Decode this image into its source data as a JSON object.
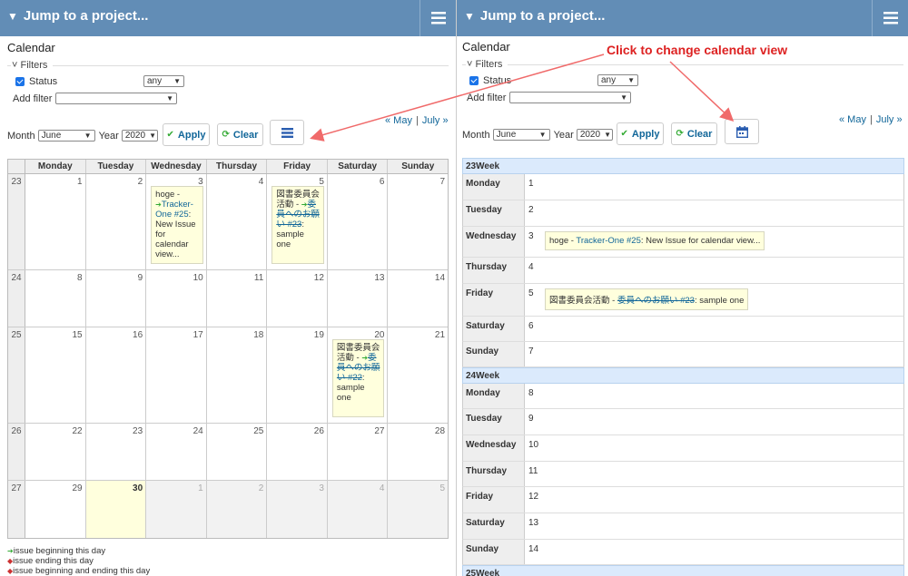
{
  "left": {
    "jump": "Jump to a project...",
    "title": "Calendar",
    "filters_label": "Filters",
    "status_label": "Status",
    "status_value": "any",
    "add_filter_label": "Add filter",
    "month_label": "Month",
    "month_value": "June",
    "year_label": "Year",
    "year_value": "2020",
    "apply": "Apply",
    "clear": "Clear",
    "prev": "« May",
    "next": "July »",
    "day_names": [
      "Monday",
      "Tuesday",
      "Wednesday",
      "Thursday",
      "Friday",
      "Saturday",
      "Sunday"
    ],
    "weeks": [
      {
        "wk": "23",
        "days": [
          "1",
          "2",
          "3",
          "4",
          "5",
          "6",
          "7"
        ]
      },
      {
        "wk": "24",
        "days": [
          "8",
          "9",
          "10",
          "11",
          "12",
          "13",
          "14"
        ]
      },
      {
        "wk": "25",
        "days": [
          "15",
          "16",
          "17",
          "18",
          "19",
          "20",
          "21"
        ]
      },
      {
        "wk": "26",
        "days": [
          "22",
          "23",
          "24",
          "25",
          "26",
          "27",
          "28"
        ]
      },
      {
        "wk": "27",
        "days": [
          "29",
          "30",
          "1",
          "2",
          "3",
          "4",
          "5"
        ]
      }
    ],
    "issue1": {
      "prefix": "hoge - ",
      "link": "Tracker-One #25",
      "suffix": ": New Issue for calendar view..."
    },
    "issue2": {
      "prefix": "図書委員会活動 - ",
      "link": "委員へのお願い #23",
      "suffix": ": sample one"
    },
    "issue3": {
      "prefix": "図書委員会活動 - ",
      "link": "委員へのお願い #22",
      "suffix": ": sample one"
    },
    "legend": [
      "issue beginning this day",
      "issue ending this day",
      "issue beginning and ending this day"
    ]
  },
  "right": {
    "jump": "Jump to a project...",
    "title": "Calendar",
    "filters_label": "Filters",
    "status_label": "Status",
    "status_value": "any",
    "add_filter_label": "Add filter",
    "month_label": "Month",
    "month_value": "June",
    "year_label": "Year",
    "year_value": "2020",
    "apply": "Apply",
    "clear": "Clear",
    "prev": "« May",
    "next": "July »",
    "weeks": [
      {
        "label": "23Week",
        "days": [
          {
            "name": "Monday",
            "num": "1"
          },
          {
            "name": "Tuesday",
            "num": "2"
          },
          {
            "name": "Wednesday",
            "num": "3"
          },
          {
            "name": "Thursday",
            "num": "4"
          },
          {
            "name": "Friday",
            "num": "5"
          },
          {
            "name": "Saturday",
            "num": "6"
          },
          {
            "name": "Sunday",
            "num": "7"
          }
        ]
      },
      {
        "label": "24Week",
        "days": [
          {
            "name": "Monday",
            "num": "8"
          },
          {
            "name": "Tuesday",
            "num": "9"
          },
          {
            "name": "Wednesday",
            "num": "10"
          },
          {
            "name": "Thursday",
            "num": "11"
          },
          {
            "name": "Friday",
            "num": "12"
          },
          {
            "name": "Saturday",
            "num": "13"
          },
          {
            "name": "Sunday",
            "num": "14"
          }
        ]
      },
      {
        "label": "25Week"
      }
    ],
    "issue_wed": {
      "prefix": "hoge - ",
      "link": "Tracker-One #25",
      "suffix": ": New Issue for calendar view..."
    },
    "issue_fri": {
      "prefix": "図書委員会活動 - ",
      "link": "委員へのお願い #23",
      "suffix": ": sample one"
    }
  },
  "callout": "Click to change calendar view",
  "colors": {
    "topbar": "#628db6",
    "link": "#169",
    "issue_bg": "#ffffdd",
    "week_head": "#dbeafc",
    "callout": "#dd2222"
  }
}
